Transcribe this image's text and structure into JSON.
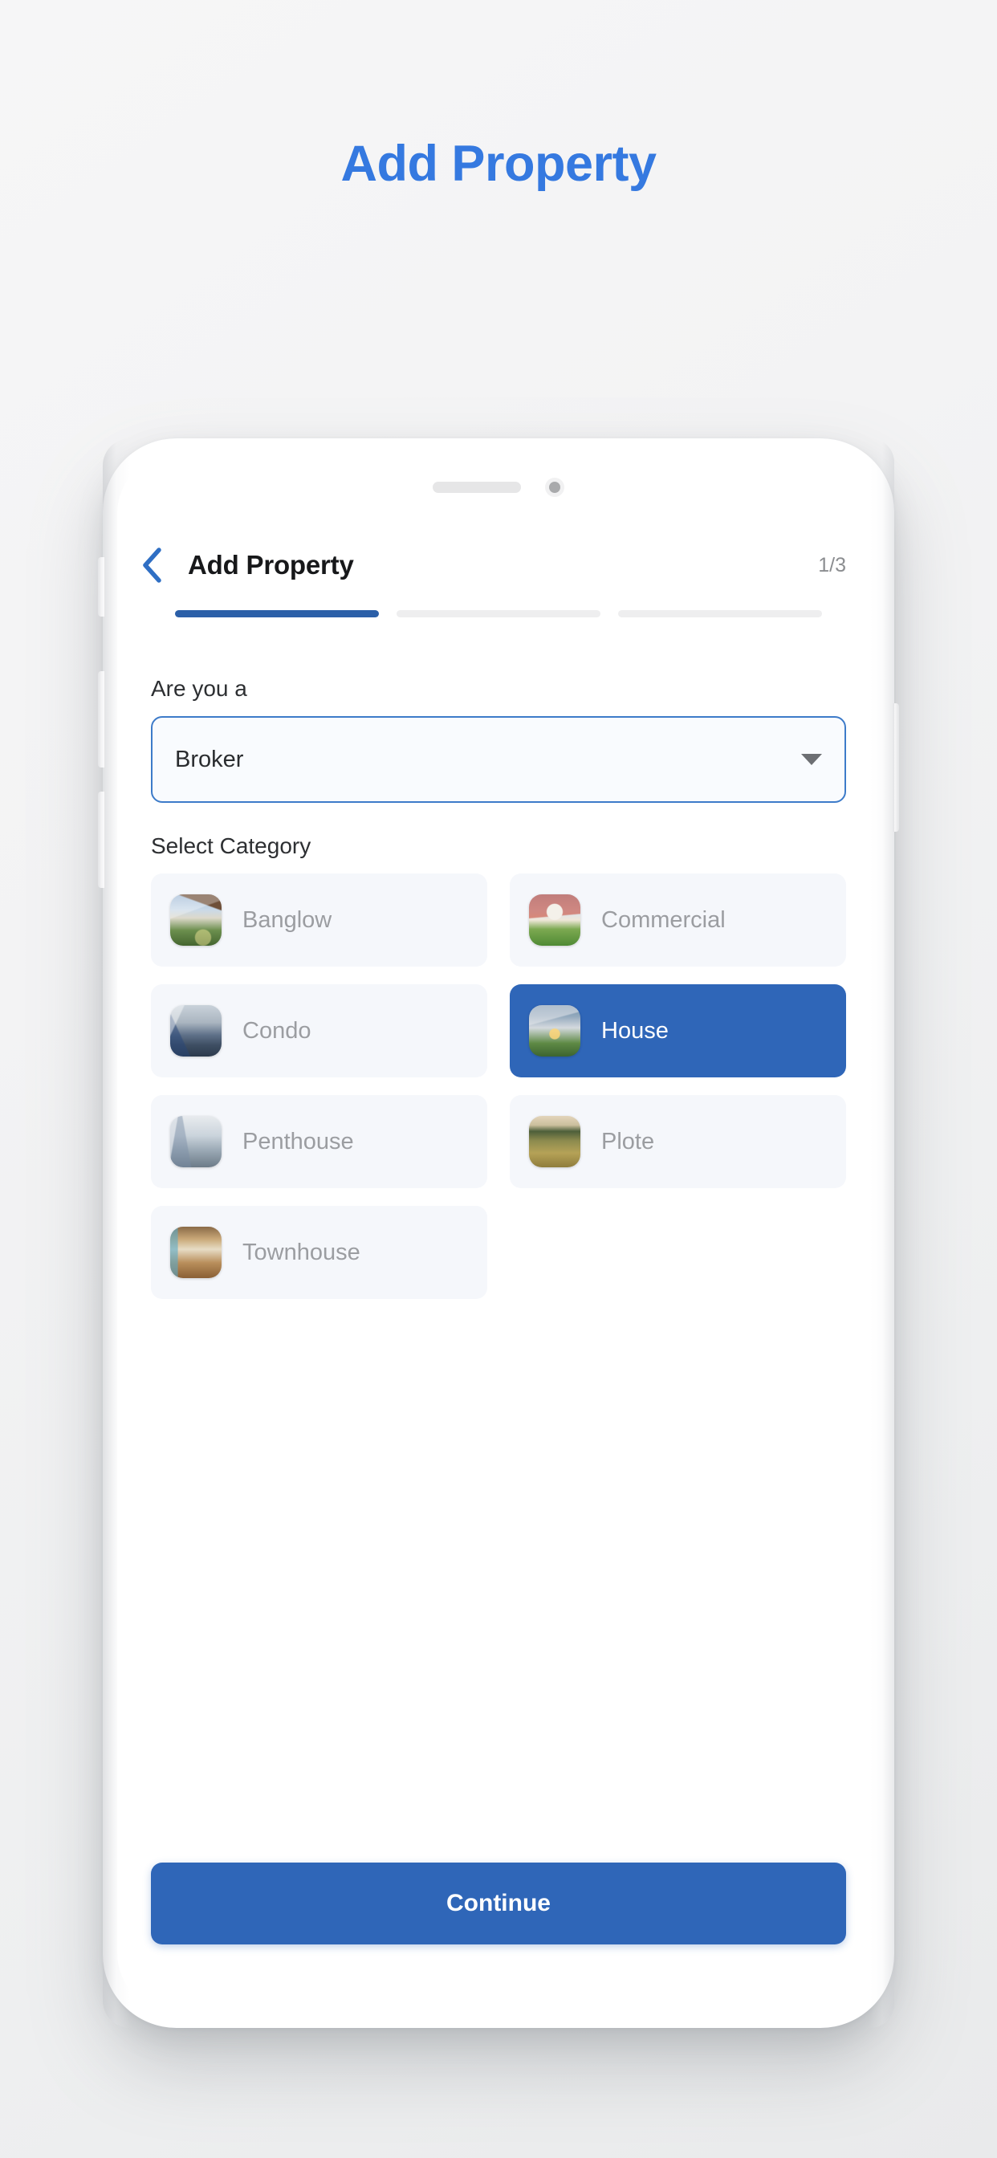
{
  "page": {
    "hero_title": "Add Property",
    "accent_blue": "#3579e0",
    "primary_blue": "#2f66b8",
    "progress_blue": "#2b5fa8",
    "background": "#f2f3f4"
  },
  "phone": {
    "earpiece_icon": "speaker-grille-icon",
    "camera_icon": "front-camera-icon",
    "buttons": [
      "mute-switch",
      "volume-up",
      "volume-down",
      "power"
    ]
  },
  "header": {
    "back_icon": "chevron-left-icon",
    "title": "Add Property",
    "step": "1/3"
  },
  "progress": {
    "total": 3,
    "current": 1,
    "segments": [
      {
        "active": true
      },
      {
        "active": false
      },
      {
        "active": false
      }
    ]
  },
  "form": {
    "role": {
      "label": "Are you a",
      "value": "Broker",
      "caret_icon": "chevron-down-icon"
    },
    "category": {
      "label": "Select Category",
      "items": [
        {
          "label": "Banglow",
          "thumb": "th-banglow",
          "selected": false
        },
        {
          "label": "Commercial",
          "thumb": "th-commercial",
          "selected": false
        },
        {
          "label": "Condo",
          "thumb": "th-condo",
          "selected": false
        },
        {
          "label": "House",
          "thumb": "th-house",
          "selected": true
        },
        {
          "label": "Penthouse",
          "thumb": "th-penthouse",
          "selected": false
        },
        {
          "label": "Plote",
          "thumb": "th-plote",
          "selected": false
        },
        {
          "label": "Townhouse",
          "thumb": "th-townhouse",
          "selected": false
        }
      ]
    }
  },
  "footer": {
    "continue_label": "Continue"
  }
}
